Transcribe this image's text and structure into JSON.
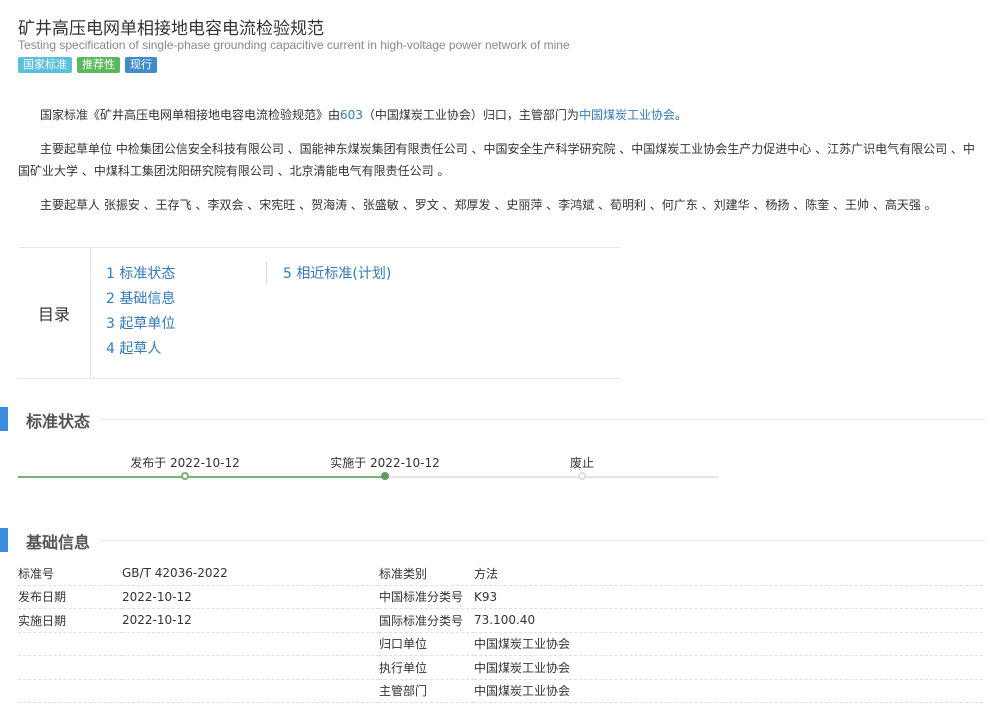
{
  "header": {
    "title": "矿井高压电网单相接地电容电流检验规范",
    "subtitle": "Testing specification of single-phase grounding capacitive current in high-voltage power network of mine",
    "badges": [
      {
        "label": "国家标准",
        "color": "#5bc0de"
      },
      {
        "label": "推荐性",
        "color": "#5cb85c"
      },
      {
        "label": "现行",
        "color": "#428bca"
      }
    ]
  },
  "intro": {
    "p1_a": "国家标准《矿井高压电网单相接地电容电流检验规范》由",
    "p1_link1": "603",
    "p1_b": "（中国煤炭工业协会）归口，主管部门为",
    "p1_link2": "中国煤炭工业协会",
    "p1_c": "。",
    "p2": "主要起草单位 中检集团公信安全科技有限公司 、国能神东煤炭集团有限责任公司 、中国安全生产科学研究院 、中国煤炭工业协会生产力促进中心 、江苏广识电气有限公司 、中国矿业大学 、中煤科工集团沈阳研究院有限公司 、北京清能电气有限责任公司 。",
    "p3": "主要起草人 张振安 、王存飞 、李双会 、宋宪旺 、贺海涛 、张盛敏 、罗文 、郑厚发 、史丽萍 、李鸿斌 、荀明利 、何广东 、刘建华 、杨扬 、陈奎 、王帅 、高天强 。"
  },
  "toc": {
    "title": "目录",
    "items": [
      "1 标准状态",
      "2 基础信息",
      "3 起草单位",
      "4 起草人",
      "5 相近标准(计划)"
    ]
  },
  "status": {
    "heading": "标准状态",
    "steps": [
      "发布于 2022-10-12",
      "实施于 2022-10-12",
      "废止"
    ],
    "track_color": "#7cae7a",
    "inactive_color": "#dddddd"
  },
  "basic": {
    "heading": "基础信息",
    "rows": [
      {
        "k1": "标准号",
        "v1": "GB/T 42036-2022",
        "k2": "标准类别",
        "v2": "方法"
      },
      {
        "k1": "发布日期",
        "v1": "2022-10-12",
        "k2": "中国标准分类号",
        "v2": "K93"
      },
      {
        "k1": "实施日期",
        "v1": "2022-10-12",
        "k2": "国际标准分类号",
        "v2": "73.100.40"
      },
      {
        "k1": "",
        "v1": "",
        "k2": "归口单位",
        "v2": "中国煤炭工业协会"
      },
      {
        "k1": "",
        "v1": "",
        "k2": "执行单位",
        "v2": "中国煤炭工业协会"
      },
      {
        "k1": "",
        "v1": "",
        "k2": "主管部门",
        "v2": "中国煤炭工业协会"
      }
    ]
  },
  "colors": {
    "accent": "#3c8dde",
    "link": "#337ab7"
  }
}
